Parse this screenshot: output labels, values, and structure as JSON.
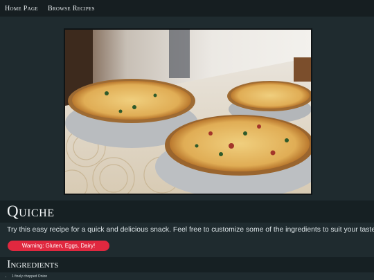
{
  "nav": {
    "home": "Home Page",
    "browse": "Browse Recipes"
  },
  "recipe": {
    "title": "Quiche",
    "description": "Try this easy recipe for a quick and delicious snack. Feel free to customize some of the ingredients to suit your taste.",
    "warning": "Warning: Gluten, Eggs, Dairy!"
  },
  "ingredients": {
    "heading": "Ingredients",
    "items": [
      "1 finely chopped Onion"
    ]
  },
  "colors": {
    "warning": "#e0283f",
    "background": "#1f2b2f"
  }
}
